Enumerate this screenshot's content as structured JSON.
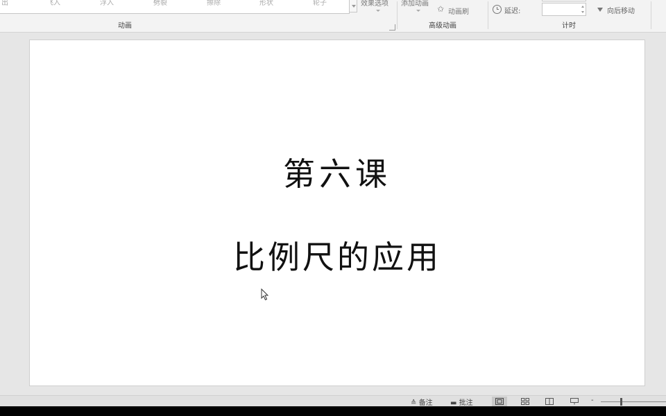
{
  "ribbon": {
    "animation_group": {
      "label": "动画",
      "items": [
        "出",
        "飞入",
        "浮入",
        "劈裂",
        "擦除",
        "形状",
        "轮子"
      ]
    },
    "effect_options_label": "效果选项",
    "advanced_group": {
      "label": "高级动画",
      "add_animation_label": "添加动画",
      "animation_painter_label": "动画刷"
    },
    "timing_group": {
      "label": "计时",
      "delay_label": "延迟:",
      "delay_value": "",
      "move_later_label": "向后移动"
    }
  },
  "slide": {
    "title": "第六课",
    "subtitle": "比例尺的应用"
  },
  "statusbar": {
    "notes_label": "备注",
    "comments_label": "批注",
    "active_view": "normal",
    "zoom_minus": "-"
  },
  "colors": {
    "ribbon_bg": "#f3f3f3",
    "workspace_bg": "#e6e6e6",
    "slide_bg": "#ffffff",
    "text_dark": "#111111"
  }
}
